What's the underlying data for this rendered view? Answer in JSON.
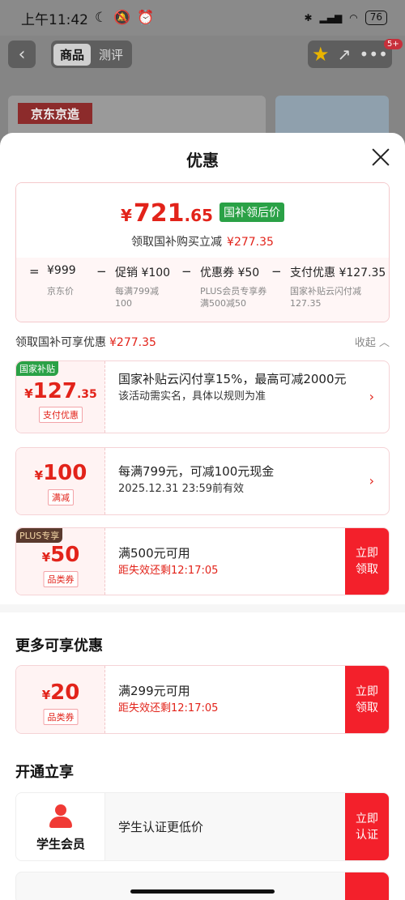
{
  "status_bar": {
    "time": "上午11:42",
    "battery": "76"
  },
  "background": {
    "back": "‹",
    "tabs": [
      "商品",
      "测评"
    ],
    "badge": "5+",
    "brand_tag": "京东京造"
  },
  "sheet": {
    "title": "优惠",
    "summary": {
      "yen": "¥",
      "price_int": "721",
      "price_dec": ".65",
      "price_tag": "国补领后价",
      "sub_label": "领取国补购买立减",
      "sub_amount": "¥277.35",
      "ops": [
        "=",
        "−",
        "−",
        "−"
      ],
      "items": [
        {
          "label": "¥999",
          "note": "京东价"
        },
        {
          "label": "促销 ¥100",
          "note": "每满799减100"
        },
        {
          "label": "优惠券 ¥50",
          "note": "PLUS会员专享券满500减50"
        },
        {
          "label": "支付优惠 ¥127.35",
          "note": "国家补贴云闪付减127.35"
        }
      ]
    },
    "section": {
      "label": "领取国补可享优惠",
      "amount": "¥277.35",
      "collapse": "收起"
    },
    "coupons": [
      {
        "badge": "国家补贴",
        "yen": "¥",
        "amount": "127",
        "dec": ".35",
        "tag": "支付优惠",
        "line1": "国家补贴云闪付享15%，最高可减2000元",
        "line2": "该活动需实名，具体以规则为准"
      },
      {
        "yen": "¥",
        "amount": "100",
        "tag": "满减",
        "line1": "每满799元，可减100元现金",
        "line2": "2025.12.31 23:59前有效"
      },
      {
        "badge": "PLUS专享",
        "yen": "¥",
        "amount": "50",
        "tag": "品类券",
        "line1": "满500元可用",
        "line2": "距失效还剩12:17:05",
        "cta": "立即领取"
      }
    ],
    "more": {
      "title": "更多可享优惠",
      "coupon": {
        "yen": "¥",
        "amount": "20",
        "tag": "品类券",
        "line1": "满299元可用",
        "line2": "距失效还剩12:17:05",
        "cta": "立即领取"
      }
    },
    "open": {
      "title": "开通立享",
      "item": {
        "label": "学生会员",
        "text": "学生认证更低价",
        "cta": "立即认证"
      }
    }
  },
  "colors": {
    "accent": "#e2231a",
    "green": "#2aa146",
    "cta": "#f3202b"
  }
}
